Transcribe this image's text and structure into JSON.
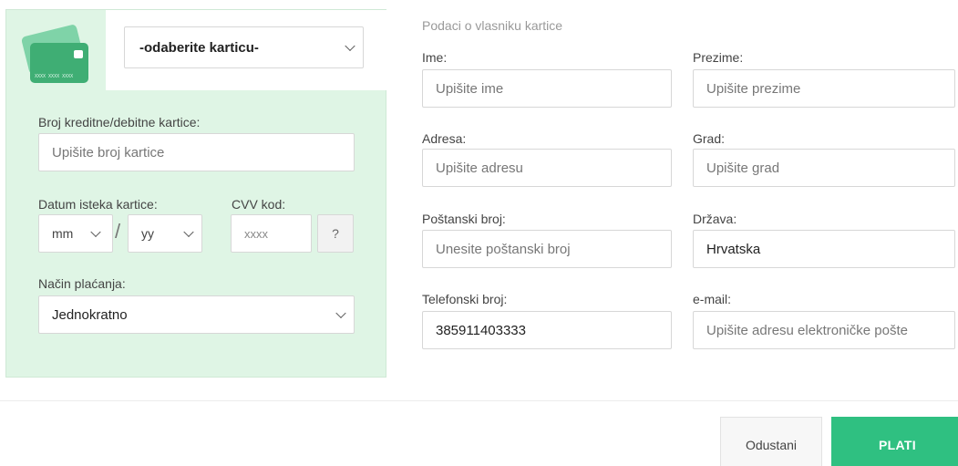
{
  "card_section": {
    "card_type_select": "-odaberite karticu-",
    "card_icon_number": "XXXX XXXX XXXX",
    "card_number_label": "Broj kreditne/debitne kartice:",
    "card_number_placeholder": "Upišite broj kartice",
    "expiry_label": "Datum isteka kartice:",
    "expiry_month": "mm",
    "expiry_separator": "/",
    "expiry_year": "yy",
    "cvv_label": "CVV kod:",
    "cvv_placeholder": "xxxx",
    "cvv_help": "?",
    "payment_method_label": "Način plaćanja:",
    "payment_method_value": "Jednokratno"
  },
  "owner_section": {
    "title": "Podaci o vlasniku kartice",
    "first_name_label": "Ime:",
    "first_name_placeholder": "Upišite ime",
    "last_name_label": "Prezime:",
    "last_name_placeholder": "Upišite prezime",
    "address_label": "Adresa:",
    "address_placeholder": "Upišite adresu",
    "city_label": "Grad:",
    "city_placeholder": "Upišite grad",
    "postal_label": "Poštanski broj:",
    "postal_placeholder": "Unesite poštanski broj",
    "country_label": "Država:",
    "country_value": "Hrvatska",
    "phone_label": "Telefonski broj:",
    "phone_value": "385911403333",
    "email_label": "e-mail:",
    "email_placeholder": "Upišite adresu elektroničke pošte"
  },
  "actions": {
    "cancel": "Odustani",
    "pay": "PLATI"
  },
  "colors": {
    "panel_bg": "#dff5e5",
    "accent": "#2fc081"
  }
}
